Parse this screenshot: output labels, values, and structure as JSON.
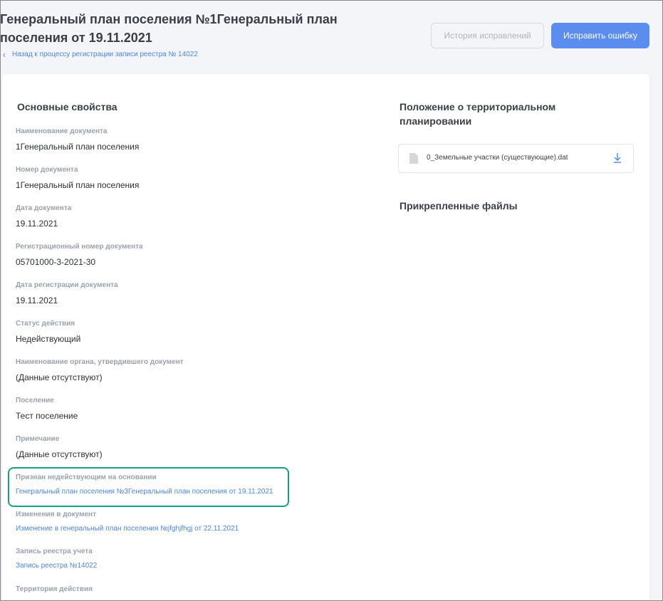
{
  "header": {
    "title": "Генеральный план поселения №1Генеральный план поселения от 19.11.2021",
    "back_link": "Назад к процессу регистрации записи реестра № 14022",
    "history_button": "История исправлений",
    "fix_button": "Исправить ошибку"
  },
  "main": {
    "section_title": "Основные свойства",
    "fields": {
      "doc_name": {
        "label": "Наименование документа",
        "value": "1Генеральный план поселения"
      },
      "doc_number": {
        "label": "Номер документа",
        "value": "1Генеральный план поселения"
      },
      "doc_date": {
        "label": "Дата документа",
        "value": "19.11.2021"
      },
      "reg_number": {
        "label": "Регистрационный номер документа",
        "value": "05701000-3-2021-30"
      },
      "reg_date": {
        "label": "Дата регистрации документа",
        "value": "19.11.2021"
      },
      "status": {
        "label": "Статус действия",
        "value": "Недействующий"
      },
      "authority": {
        "label": "Наименование органа, утвердившего документ",
        "value": "(Данные отсутствуют)"
      },
      "settlement": {
        "label": "Поселение",
        "value": "Тест поселение"
      },
      "note": {
        "label": "Примечание",
        "value": "(Данные отсутствуют)"
      },
      "invalid_basis": {
        "label": "Признан недействующим на основании",
        "value": "Генеральный план поселения №3Генеральный план поселения от 19.11.2021"
      },
      "changes": {
        "label": "Изменения в документ",
        "value": "Изменение в генеральный план поселения №jfghjfhgj от 22.11.2021"
      },
      "registry_record": {
        "label": "Запись реестра учета",
        "value": "Запись реестра №14022"
      },
      "territory": {
        "label": "Территория действия"
      }
    }
  },
  "side": {
    "planning_title": "Положение о территориальном планировании",
    "file_name": "0_Земельные участки (существующие).dat",
    "attached_title": "Прикрепленные файлы"
  },
  "colors": {
    "accent": "#5b8def",
    "link": "#4a86e8",
    "highlight": "#14a085"
  }
}
